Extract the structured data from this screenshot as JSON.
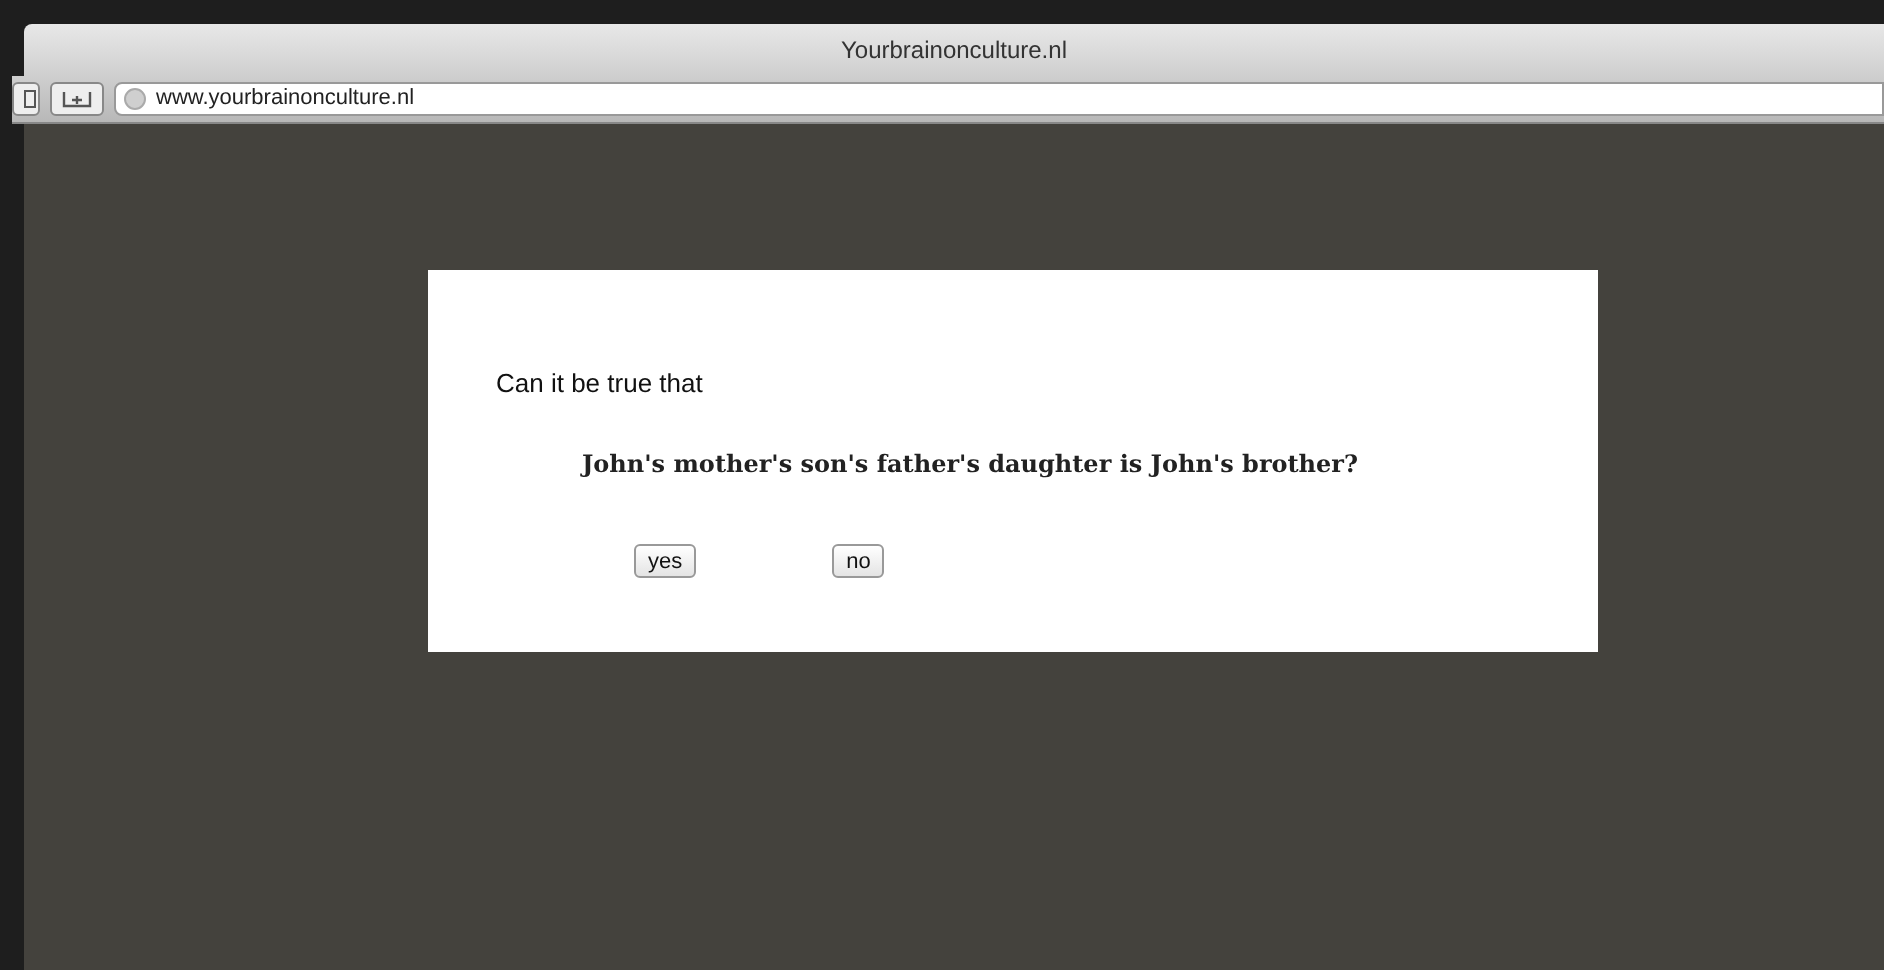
{
  "window": {
    "title": "Yourbrainonculture.nl"
  },
  "address_bar": {
    "url": "www.yourbrainonculture.nl"
  },
  "dialog": {
    "prompt": "Can it be true that",
    "question": "John's mother's son's father's daughter is John's brother?",
    "buttons": [
      "yes",
      "no"
    ]
  }
}
